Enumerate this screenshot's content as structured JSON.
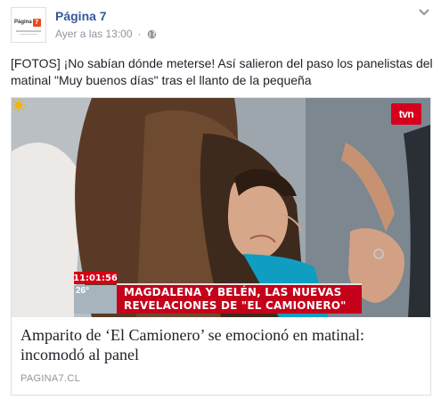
{
  "post": {
    "page_name": "Página 7",
    "timestamp": "Ayer a las 13:00",
    "separator": "·",
    "text": "[FOTOS] ¡No sabían dónde meterse! Así salieron del paso los panelistas del matinal \"Muy buenos días\" tras el llanto de la pequeña",
    "avatar_logo_text": "Página",
    "avatar_logo_number": "7"
  },
  "link": {
    "title": "Amparito de ‘El Camionero’ se emocionó en matinal: incomodó al panel",
    "domain": "PAGINA7.CL",
    "image": {
      "channel_logo": "tvn",
      "clock": "11:01:56",
      "temperature": "26°",
      "headline_line1": "MAGDALENA Y BELÉN, LAS NUEVAS",
      "headline_line2": "REVELACIONES DE \"EL CAMIONERO\""
    }
  },
  "icons": {
    "globe": "globe-icon",
    "chevron": "chevron-down-icon",
    "weather": "sun-icon"
  },
  "colors": {
    "link_blue": "#365899",
    "meta_gray": "#90949c",
    "tv_red": "#c4001a"
  }
}
